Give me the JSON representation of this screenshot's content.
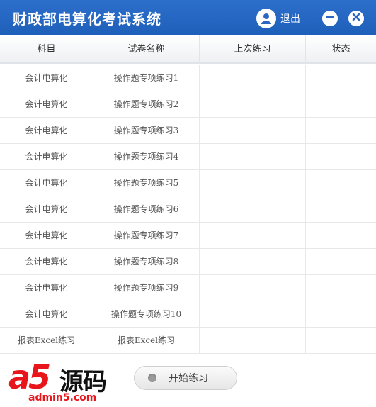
{
  "titlebar": {
    "title": "财政部电算化考试系统",
    "logout_label": "退出"
  },
  "table": {
    "headers": [
      "科目",
      "试卷名称",
      "上次练习",
      "状态"
    ],
    "rows": [
      {
        "subject": "会计电算化",
        "paper": "操作题专项练习1",
        "last": "",
        "status": ""
      },
      {
        "subject": "会计电算化",
        "paper": "操作题专项练习2",
        "last": "",
        "status": ""
      },
      {
        "subject": "会计电算化",
        "paper": "操作题专项练习3",
        "last": "",
        "status": ""
      },
      {
        "subject": "会计电算化",
        "paper": "操作题专项练习4",
        "last": "",
        "status": ""
      },
      {
        "subject": "会计电算化",
        "paper": "操作题专项练习5",
        "last": "",
        "status": ""
      },
      {
        "subject": "会计电算化",
        "paper": "操作题专项练习6",
        "last": "",
        "status": ""
      },
      {
        "subject": "会计电算化",
        "paper": "操作题专项练习7",
        "last": "",
        "status": ""
      },
      {
        "subject": "会计电算化",
        "paper": "操作题专项练习8",
        "last": "",
        "status": ""
      },
      {
        "subject": "会计电算化",
        "paper": "操作题专项练习9",
        "last": "",
        "status": ""
      },
      {
        "subject": "会计电算化",
        "paper": "操作题专项练习10",
        "last": "",
        "status": ""
      },
      {
        "subject": "报表Excel练习",
        "paper": "报表Excel练习",
        "last": "",
        "status": ""
      }
    ]
  },
  "footer": {
    "start_label": "开始练习"
  },
  "watermark": {
    "brand": "a5",
    "brand_cn": "源码",
    "url": "admin5.com"
  },
  "icons": {
    "user": "user-icon",
    "minimize": "minimize-icon",
    "close": "close-icon",
    "start": "radio-dot-icon"
  },
  "colors": {
    "titlebar": "#1e5fb9",
    "watermark_red": "#e8161b"
  }
}
